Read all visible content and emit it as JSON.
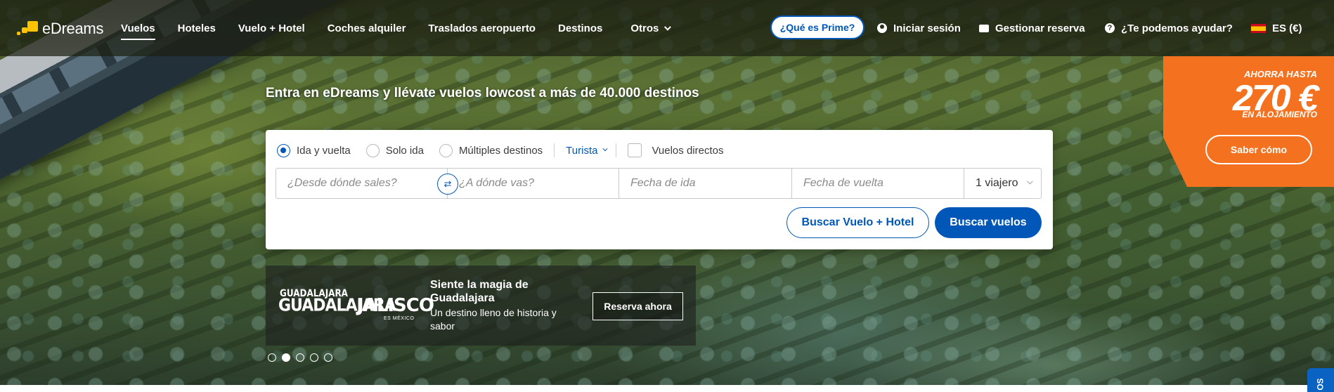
{
  "brand": {
    "name": "eDreams",
    "accent": "#0057b8",
    "logo_color": "#ffc300"
  },
  "nav": {
    "items": [
      {
        "label": "Vuelos",
        "active": true
      },
      {
        "label": "Hoteles"
      },
      {
        "label": "Vuelo + Hotel"
      },
      {
        "label": "Coches alquiler"
      },
      {
        "label": "Traslados aeropuerto"
      },
      {
        "label": "Destinos"
      }
    ],
    "others_label": "Otros",
    "prime_label": "¿Qué es Prime?",
    "login_label": "Iniciar sesión",
    "manage_label": "Gestionar reserva",
    "help_label": "¿Te podemos ayudar?",
    "locale_label": "ES (€)"
  },
  "hero": {
    "tagline": "Entra en eDreams y llévate vuelos lowcost a más de 40.000 destinos"
  },
  "search": {
    "trip_types": [
      {
        "label": "Ida y vuelta",
        "checked": true
      },
      {
        "label": "Solo ida",
        "checked": false
      },
      {
        "label": "Múltiples destinos",
        "checked": false
      }
    ],
    "cabin_class": "Turista",
    "direct_label": "Vuelos directos",
    "from_placeholder": "¿Desde dónde sales?",
    "to_placeholder": "¿A dónde vas?",
    "departure_placeholder": "Fecha de ida",
    "return_placeholder": "Fecha de vuelta",
    "travellers": "1 viajero",
    "combo_button": "Buscar Vuelo + Hotel",
    "search_button": "Buscar vuelos"
  },
  "promo": {
    "logo_guadalajara": "GUADALAJARA",
    "logo_guadalajara_small": "GUADALAJARA",
    "logo_jalisco": "JALISCO",
    "logo_jalisco_sub": "ES MÉXICO",
    "title": "Siente la magia de Guadalajara",
    "description": "Un destino lleno de historia y sabor",
    "button": "Reserva ahora"
  },
  "carousel": {
    "count": 5,
    "active_index": 1
  },
  "offer": {
    "top": "AHORRA HASTA",
    "amount": "270 €",
    "sub": "EN ALOJAMIENTO",
    "button": "Saber cómo",
    "color": "#f4721f"
  },
  "side_tab": {
    "label": "OS"
  }
}
